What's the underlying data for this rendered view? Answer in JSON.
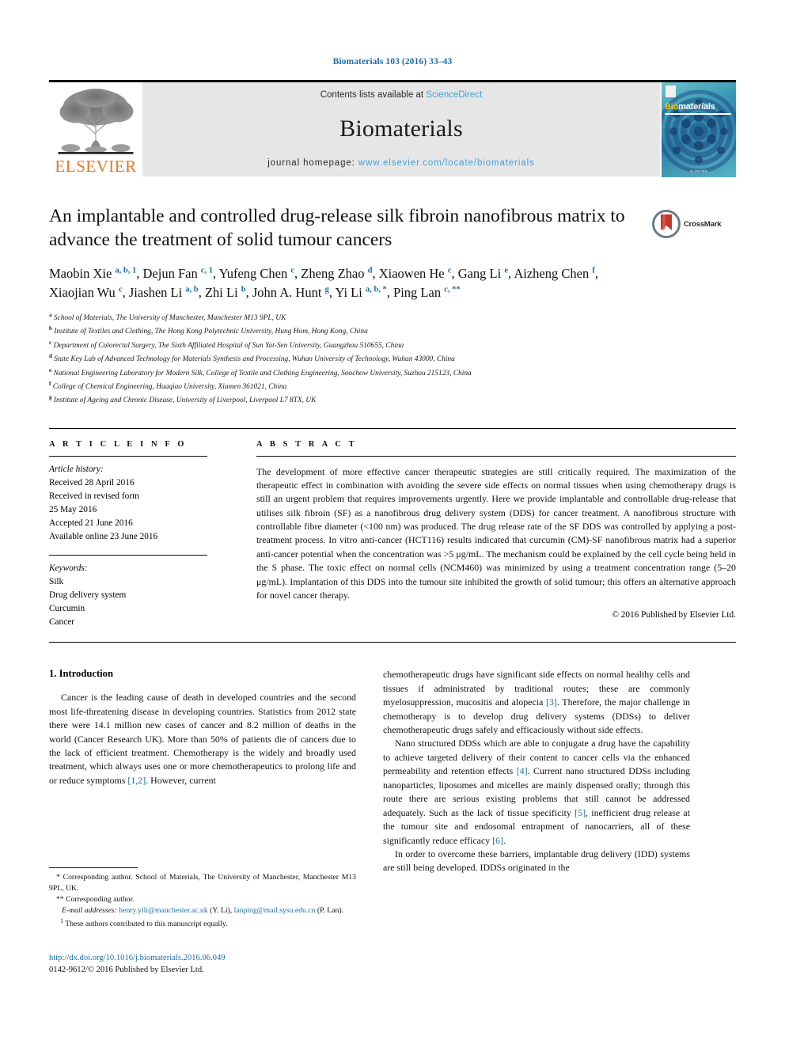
{
  "running_head": "Biomaterials 103 (2016) 33–43",
  "masthead": {
    "publisher_name": "ELSEVIER",
    "contents_prefix": "Contents lists available at ",
    "contents_link": "ScienceDirect",
    "journal_name": "Biomaterials",
    "homepage_prefix": "journal homepage: ",
    "homepage_url": "www.elsevier.com/locate/biomaterials",
    "cover_title_bio": "Bio",
    "cover_title_materials": "materials",
    "cover_footer": "ELSEVIER"
  },
  "article": {
    "title": "An implantable and controlled drug-release silk fibroin nanofibrous matrix to advance the treatment of solid tumour cancers",
    "crossmark_label": "CrossMark",
    "authors_html": "Maobin Xie <sup>a, b, 1</sup>, Dejun Fan <sup>c, 1</sup>, Yufeng Chen <sup>c</sup>, Zheng Zhao <sup>d</sup>, Xiaowen He <sup>c</sup>, Gang Li <sup>e</sup>, Aizheng Chen <sup>f</sup>, Xiaojian Wu <sup>c</sup>, Jiashen Li <sup>a, b</sup>, Zhi Li <sup>b</sup>, John A. Hunt <sup>g</sup>, Yi Li <sup>a, b, *</sup>, Ping Lan <sup>c, **</sup>",
    "affiliations": [
      {
        "marker": "a",
        "text": "School of Materials, The University of Manchester, Manchester M13 9PL, UK"
      },
      {
        "marker": "b",
        "text": "Institute of Textiles and Clothing, The Hong Kong Polytechnic University, Hung Hom, Hong Kong, China"
      },
      {
        "marker": "c",
        "text": "Department of Colorectal Surgery, The Sixth Affiliated Hospital of Sun Yat-Sen University, Guangzhou 510655, China"
      },
      {
        "marker": "d",
        "text": "State Key Lab of Advanced Technology for Materials Synthesis and Processing, Wuhan University of Technology, Wuhan 43000, China"
      },
      {
        "marker": "e",
        "text": "National Engineering Laboratory for Modern Silk, College of Textile and Clothing Engineering, Soochow University, Suzhou 215123, China"
      },
      {
        "marker": "f",
        "text": "College of Chemical Engineering, Huaqiao University, Xiamen 361021, China"
      },
      {
        "marker": "g",
        "text": "Institute of Ageing and Chronic Disease, University of Liverpool, Liverpool L7 8TX, UK"
      }
    ]
  },
  "article_info": {
    "heading": "A R T I C L E  I N F O",
    "history_label": "Article history:",
    "history": [
      "Received 28 April 2016",
      "Received in revised form",
      "25 May 2016",
      "Accepted 21 June 2016",
      "Available online 23 June 2016"
    ],
    "keywords_label": "Keywords:",
    "keywords": [
      "Silk",
      "Drug delivery system",
      "Curcumin",
      "Cancer"
    ]
  },
  "abstract": {
    "heading": "A B S T R A C T",
    "text": "The development of more effective cancer therapeutic strategies are still critically required. The maximization of the therapeutic effect in combination with avoiding the severe side effects on normal tissues when using chemotherapy drugs is still an urgent problem that requires improvements urgently. Here we provide implantable and controllable drug-release that utilises silk fibroin (SF) as a nanofibrous drug delivery system (DDS) for cancer treatment. A nanofibrous structure with controllable fibre diameter (<100 nm) was produced. The drug release rate of the SF DDS was controlled by applying a post-treatment process. In vitro anti-cancer (HCT116) results indicated that curcumin (CM)-SF nanofibrous matrix had a superior anti-cancer potential when the concentration was >5 μg/mL. The mechanism could be explained by the cell cycle being held in the S phase. The toxic effect on normal cells (NCM460) was minimized by using a treatment concentration range (5–20 μg/mL). Implantation of this DDS into the tumour site inhibited the growth of solid tumour; this offers an alternative approach for novel cancer therapy.",
    "copyright": "© 2016 Published by Elsevier Ltd."
  },
  "introduction": {
    "section_title": "1. Introduction",
    "left_para_1_a": "Cancer is the leading cause of death in developed countries and the second most life-threatening disease in developing countries. Statistics from 2012 state there were 14.1 million new cases of cancer and 8.2 million of deaths in the world (Cancer Research UK). More than 50% of patients die of cancers due to the lack of efficient treatment. Chemotherapy is the widely and broadly used treatment, which always uses one or more chemotherapeutics to prolong life and or reduce symptoms ",
    "left_para_1_ref": "[1,2]",
    "left_para_1_b": ". However, current",
    "right_para_1_a": "chemotherapeutic drugs have significant side effects on normal healthy cells and tissues if administrated by traditional routes; these are commonly myelosuppression, mucositis and alopecia ",
    "right_para_1_ref": "[3]",
    "right_para_1_b": ". Therefore, the major challenge in chemotherapy is to develop drug delivery systems (DDSs) to deliver chemotherapeutic drugs safely and efficaciously without side effects.",
    "right_para_2_a": "Nano structured DDSs which are able to conjugate a drug have the capability to achieve targeted delivery of their content to cancer cells via the enhanced permeability and retention effects ",
    "right_para_2_ref1": "[4]",
    "right_para_2_b": ". Current nano structured DDSs including nanoparticles, liposomes and micelles are mainly dispensed orally; through this route there are serious existing problems that still cannot be addressed adequately. Such as the lack of tissue specificity ",
    "right_para_2_ref2": "[5]",
    "right_para_2_c": ", inefficient drug release at the tumour site and endosomal entrapment of nanocarriers, all of these significantly reduce efficacy ",
    "right_para_2_ref3": "[6]",
    "right_para_2_d": ".",
    "right_para_3": "In order to overcome these barriers, implantable drug delivery (IDD) systems are still being developed. IDDSs originated in the"
  },
  "footnotes": {
    "corresponding_1": "* Corresponding author. School of Materials, The University of Manchester, Manchester M13 9PL, UK.",
    "corresponding_2": "** Corresponding author.",
    "email_label": "E-mail addresses:",
    "email_1": "henry.yili@manchester.ac.uk",
    "email_1_owner": " (Y. Li), ",
    "email_2": "lanping@mail.sysu.edu.cn",
    "email_2_owner": " (P. Lan).",
    "equal_contrib_marker": "1",
    "equal_contrib": " These authors contributed to this manuscript equally."
  },
  "footer": {
    "doi": "http://dx.doi.org/10.1016/j.biomaterials.2016.06.049",
    "issn": "0142-9612/© 2016 Published by Elsevier Ltd."
  },
  "colors": {
    "link_blue": "#1c6ea4",
    "sciencedirect_blue": "#4a9fd4",
    "elsevier_orange": "#E87722",
    "band_grey": "#e6e6e6"
  }
}
